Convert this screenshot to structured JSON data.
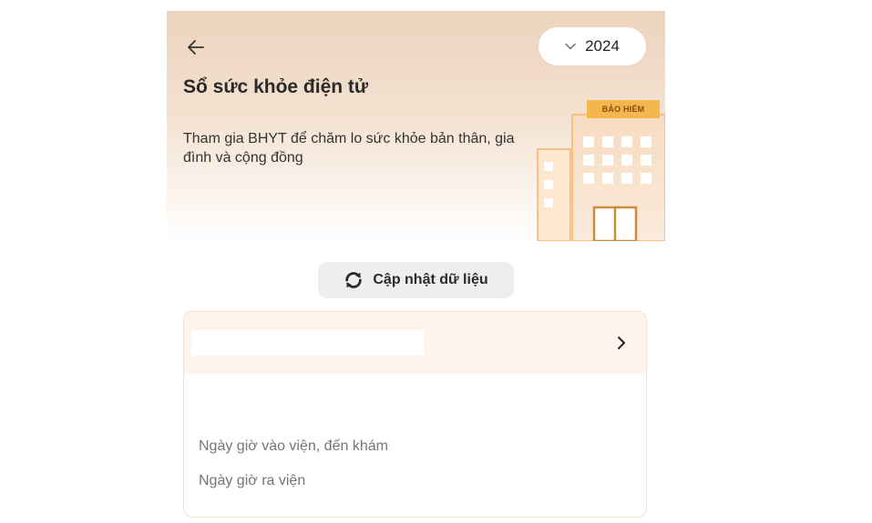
{
  "header": {
    "title": "Sổ sức khỏe điện tử",
    "subtitle": "Tham gia BHYT để chăm lo sức khỏe bản thân, gia đình và cộng đồng",
    "back_icon": "arrow-left-icon",
    "year_select": {
      "value": "2024",
      "icon": "chevron-down-icon"
    },
    "illustration_sign": "BẢO HIỂM"
  },
  "refresh_button": {
    "label": "Cập nhật dữ liệu",
    "icon": "refresh-icon"
  },
  "record_card": {
    "chevron_icon": "chevron-right-icon",
    "fields": [
      {
        "label": "Ngày giờ vào viện, đến khám"
      },
      {
        "label": "Ngày giờ ra viện"
      }
    ]
  },
  "colors": {
    "header_gradient_top": "#ecd3bd",
    "accent_orange": "#f6b64e",
    "card_header_bg": "#fdf5ed",
    "refresh_bg": "#eeeeee"
  }
}
